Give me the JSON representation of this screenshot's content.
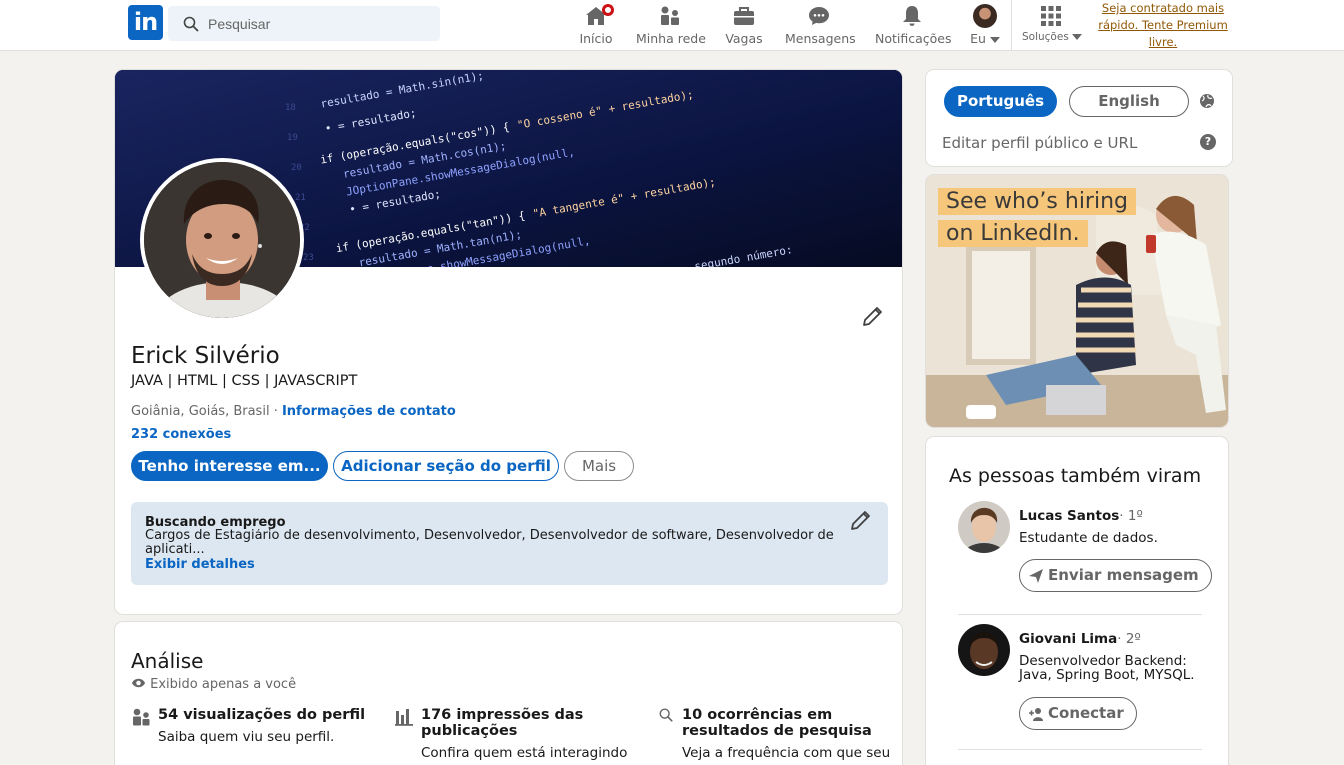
{
  "nav": {
    "search_placeholder": "Pesquisar",
    "items": [
      {
        "label": "Início",
        "icon": "home-icon"
      },
      {
        "label": "Minha rede",
        "icon": "network-icon"
      },
      {
        "label": "Vagas",
        "icon": "briefcase-icon"
      },
      {
        "label": "Mensagens",
        "icon": "messaging-icon"
      },
      {
        "label": "Notificações",
        "icon": "bell-icon"
      },
      {
        "label": "Eu",
        "icon": "avatar"
      },
      {
        "label": "Soluções",
        "icon": "grid-icon"
      }
    ],
    "premium_text": "Seja contratado mais rápido. Tente Premium livre."
  },
  "profile": {
    "name": "Erick Silvério",
    "headline": "JAVA | HTML | CSS | JAVASCRIPT",
    "location": "Goiânia, Goiás, Brasil",
    "contact_link": "Informações de contato",
    "connections": "232 conexões",
    "buttons": {
      "interest": "Tenho interesse em...",
      "add_section": "Adicionar seção do perfil",
      "more": "Mais"
    },
    "open_to_work": {
      "title": "Buscando emprego",
      "description": "Cargos de Estagiário de desenvolvimento, Desenvolvedor, Desenvolvedor de software, Desenvolvedor de aplicati...",
      "link": "Exibir detalhes"
    }
  },
  "analytics": {
    "title": "Análise",
    "subtitle": "Exibido apenas a você",
    "metrics": [
      {
        "title": "54 visualizações do perfil",
        "desc": "Saiba quem viu seu perfil.",
        "icon": "people-icon"
      },
      {
        "title": "176 impressões das publicações",
        "desc": "Confira quem está interagindo",
        "icon": "bar-chart-icon"
      },
      {
        "title": "10 ocorrências em resultados de pesquisa",
        "desc": "Veja a frequência com que seu",
        "icon": "search-icon"
      }
    ]
  },
  "sidebar": {
    "languages": [
      "Português",
      "English"
    ],
    "edit_url": "Editar perfil público e URL",
    "ad": {
      "line1": "See who’s hiring",
      "line2": "on LinkedIn."
    },
    "people_title": "As pessoas também viram",
    "people": [
      {
        "name": "Lucas Santos",
        "degree": "· 1º",
        "desc": "Estudante de dados.",
        "action": "Enviar mensagem"
      },
      {
        "name": "Giovani Lima",
        "degree": "· 2º",
        "desc": "Desenvolvedor Backend: Java, Spring Boot, MYSQL.",
        "action": "Conectar"
      }
    ]
  },
  "colors": {
    "brand": "#0a66c2",
    "background": "#f3f2ef",
    "premium": "#915907"
  }
}
